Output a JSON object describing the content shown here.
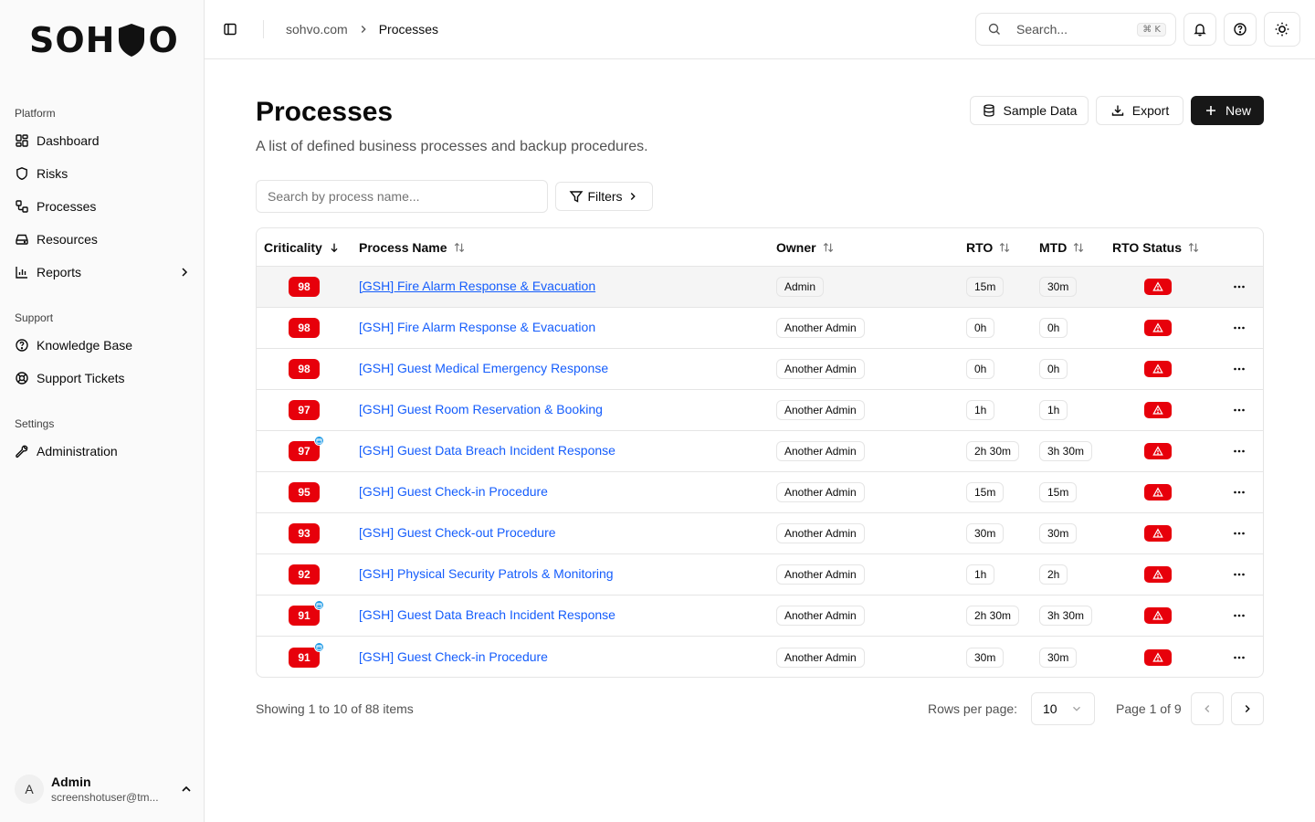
{
  "app": {
    "logo_text": "SOHVO",
    "logo_left": "SOH",
    "logo_right": "O"
  },
  "sidebar": {
    "groups": [
      {
        "label": "Platform",
        "items": [
          {
            "label": "Dashboard",
            "icon": "dashboard-icon"
          },
          {
            "label": "Risks",
            "icon": "shield-icon"
          },
          {
            "label": "Processes",
            "icon": "workflow-icon"
          },
          {
            "label": "Resources",
            "icon": "hard-drive-icon"
          },
          {
            "label": "Reports",
            "icon": "bar-chart-icon",
            "has_submenu": true
          }
        ]
      },
      {
        "label": "Support",
        "items": [
          {
            "label": "Knowledge Base",
            "icon": "help-circle-icon"
          },
          {
            "label": "Support Tickets",
            "icon": "life-buoy-icon"
          }
        ]
      },
      {
        "label": "Settings",
        "items": [
          {
            "label": "Administration",
            "icon": "wrench-icon"
          }
        ]
      }
    ],
    "user": {
      "initial": "A",
      "name": "Admin",
      "email": "screenshotuser@tm..."
    }
  },
  "header": {
    "breadcrumb": {
      "root": "sohvo.com",
      "current": "Processes"
    },
    "search": {
      "placeholder": "Search...",
      "shortcut": "⌘ K"
    }
  },
  "page": {
    "title": "Processes",
    "subtitle": "A list of defined business processes and backup procedures.",
    "buttons": {
      "sample_data": "Sample Data",
      "export": "Export",
      "new": "New"
    },
    "table_search_placeholder": "Search by process name...",
    "filters_label": "Filters"
  },
  "table": {
    "columns": {
      "criticality": "Criticality",
      "name": "Process Name",
      "owner": "Owner",
      "rto": "RTO",
      "mtd": "MTD",
      "status": "RTO Status"
    },
    "rows": [
      {
        "criticality": "98",
        "name": "[GSH] Fire Alarm Response & Evacuation",
        "owner": "Admin",
        "rto": "15m",
        "mtd": "30m",
        "dot": false,
        "highlight": true
      },
      {
        "criticality": "98",
        "name": "[GSH] Fire Alarm Response & Evacuation",
        "owner": "Another Admin",
        "rto": "0h",
        "mtd": "0h",
        "dot": false,
        "highlight": false
      },
      {
        "criticality": "98",
        "name": "[GSH] Guest Medical Emergency Response",
        "owner": "Another Admin",
        "rto": "0h",
        "mtd": "0h",
        "dot": false,
        "highlight": false
      },
      {
        "criticality": "97",
        "name": "[GSH] Guest Room Reservation & Booking",
        "owner": "Another Admin",
        "rto": "1h",
        "mtd": "1h",
        "dot": false,
        "highlight": false
      },
      {
        "criticality": "97",
        "name": "[GSH] Guest Data Breach Incident Response",
        "owner": "Another Admin",
        "rto": "2h 30m",
        "mtd": "3h 30m",
        "dot": true,
        "highlight": false
      },
      {
        "criticality": "95",
        "name": "[GSH] Guest Check-in Procedure",
        "owner": "Another Admin",
        "rto": "15m",
        "mtd": "15m",
        "dot": false,
        "highlight": false
      },
      {
        "criticality": "93",
        "name": "[GSH] Guest Check-out Procedure",
        "owner": "Another Admin",
        "rto": "30m",
        "mtd": "30m",
        "dot": false,
        "highlight": false
      },
      {
        "criticality": "92",
        "name": "[GSH] Physical Security Patrols & Monitoring",
        "owner": "Another Admin",
        "rto": "1h",
        "mtd": "2h",
        "dot": false,
        "highlight": false
      },
      {
        "criticality": "91",
        "name": "[GSH] Guest Data Breach Incident Response",
        "owner": "Another Admin",
        "rto": "2h 30m",
        "mtd": "3h 30m",
        "dot": true,
        "highlight": false
      },
      {
        "criticality": "91",
        "name": "[GSH] Guest Check-in Procedure",
        "owner": "Another Admin",
        "rto": "30m",
        "mtd": "30m",
        "dot": true,
        "highlight": false
      }
    ]
  },
  "pagination": {
    "showing": "Showing 1 to 10 of 88 items",
    "rows_per_page_label": "Rows per page:",
    "rows_per_page_value": "10",
    "page_info": "Page 1 of 9"
  },
  "colors": {
    "critical_red": "#e7000b",
    "link_blue": "#155dfc",
    "primary_dark": "#171717",
    "border": "#e5e5e5"
  }
}
